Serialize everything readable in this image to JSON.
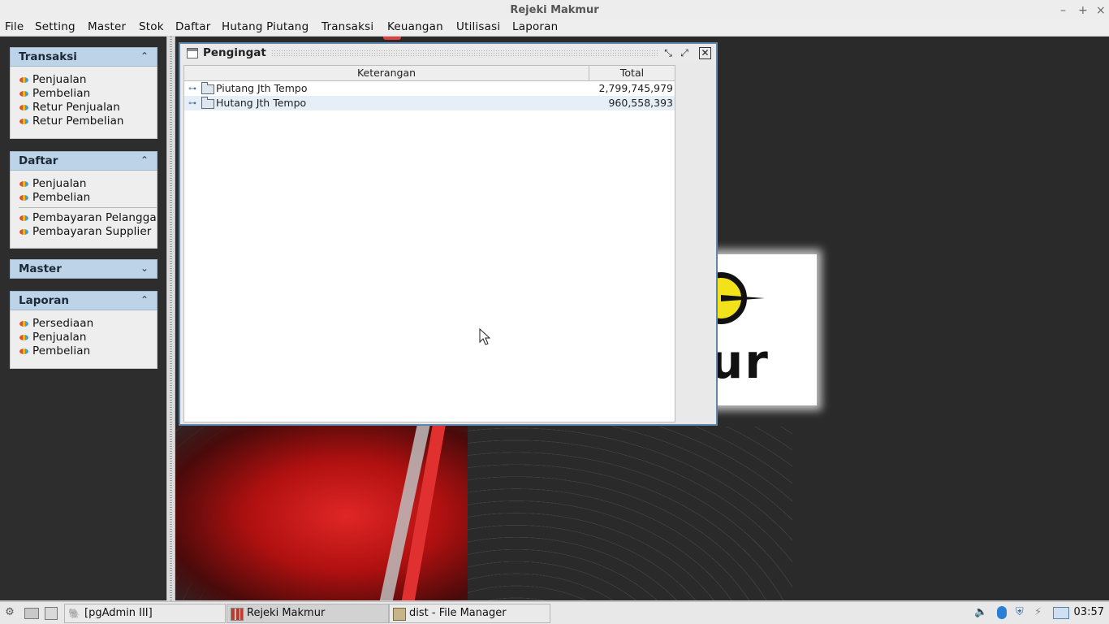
{
  "window": {
    "title": "Rejeki Makmur",
    "controls": [
      "–",
      "+",
      "×"
    ]
  },
  "menubar": [
    "File",
    "Setting",
    "Master",
    "Stok",
    "Daftar",
    "Hutang Piutang",
    "Transaksi",
    "Keuangan",
    "Utilisasi",
    "Laporan"
  ],
  "sidebar": {
    "groups": [
      {
        "title": "Transaksi",
        "chevron": "⌃",
        "items": [
          "Penjualan",
          "Pembelian",
          "Retur Penjualan",
          "Retur Pembelian"
        ]
      },
      {
        "title": "Daftar",
        "chevron": "⌃",
        "items": [
          "Penjualan",
          "Pembelian",
          "Pembayaran Pelanggan",
          "Pembayaran Supplier"
        ]
      },
      {
        "title": "Master",
        "chevron": "⌄",
        "items": []
      },
      {
        "title": "Laporan",
        "chevron": "⌃",
        "items": [
          "Persediaan",
          "Penjualan",
          "Pembelian"
        ]
      }
    ]
  },
  "logo": {
    "text": "ur",
    "colors": {
      "wheel": "#f3e21a"
    }
  },
  "pengingat": {
    "title": "Pengingat",
    "columns": [
      "Keterangan",
      "Total"
    ],
    "rows": [
      {
        "label": "Piutang Jth Tempo",
        "total": "2,799,745,979"
      },
      {
        "label": "Hutang Jth Tempo",
        "total": "960,558,393"
      }
    ],
    "buttons": [
      "iconify-icon",
      "maximize-icon",
      "close-icon"
    ]
  },
  "taskbar": {
    "tasks": [
      {
        "label": "[pgAdmin III]",
        "icon": "elephant-icon",
        "active": false
      },
      {
        "label": "Rejeki Makmur",
        "icon": "java-app-icon",
        "active": true
      },
      {
        "label": "dist - File Manager",
        "icon": "folder-icon",
        "active": false
      }
    ],
    "clock": "03:57"
  },
  "colors": {
    "accent": "#5e86ad",
    "group_header": "#bcd3e8",
    "row_alt": "#e6eef7"
  }
}
